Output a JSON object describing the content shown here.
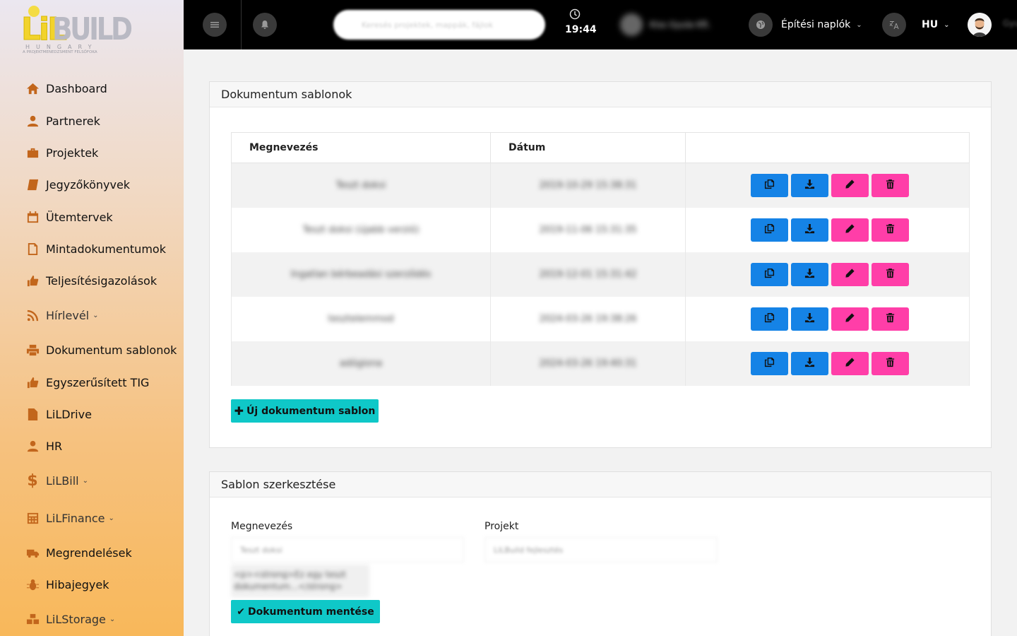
{
  "logo": {
    "brand_left": "LiL",
    "brand_right": "BUILD",
    "country": "HUNGARY",
    "tagline": "A PROJEKTMENEDZSMENT FELSŐFOKA"
  },
  "sidebar": {
    "items": [
      {
        "label": "Dashboard",
        "icon": "home-icon"
      },
      {
        "label": "Partnerek",
        "icon": "user-icon"
      },
      {
        "label": "Projektek",
        "icon": "briefcase-icon"
      },
      {
        "label": "Jegyzőkönyvek",
        "icon": "book-icon"
      },
      {
        "label": "Ütemtervek",
        "icon": "calendar-icon"
      },
      {
        "label": "Mintadokumentumok",
        "icon": "file-code-icon"
      },
      {
        "label": "Teljesítésigazolások",
        "icon": "thumbs-up-icon"
      },
      {
        "label": "Hírlevél",
        "icon": "rss-icon",
        "dropdown": true
      },
      {
        "label": "Dokumentum sablonok",
        "icon": "print-icon"
      },
      {
        "label": "Egyszerűsített TIG",
        "icon": "thumbs-up-icon"
      },
      {
        "label": "LiLDrive",
        "icon": "file-icon"
      },
      {
        "label": "HR",
        "icon": "user-icon"
      },
      {
        "label": "LiLBill",
        "icon": "dollar-icon",
        "dropdown": true
      },
      {
        "label": "LiLFinance",
        "icon": "calculator-icon",
        "dropdown": true
      },
      {
        "label": "Megrendelések",
        "icon": "truck-icon"
      },
      {
        "label": "Hibajegyek",
        "icon": "bug-icon"
      },
      {
        "label": "LiLStorage",
        "icon": "cubes-icon",
        "dropdown": true
      }
    ]
  },
  "topbar": {
    "search_placeholder": "Keresés projektek, mappák, fájlok",
    "time": "19:44",
    "user_name": "Kiss Gyula Kft.",
    "diaries_label": "Építési naplók",
    "language": "HU",
    "profile_name": "Gyula"
  },
  "templates_card": {
    "title": "Dokumentum sablonok",
    "columns": {
      "name": "Megnevezés",
      "date": "Dátum",
      "actions": ""
    },
    "rows": [
      {
        "name": "Teszt doksi",
        "date": "2019-10-29 15:38:31"
      },
      {
        "name": "Teszt doksi (újabb verzió)",
        "date": "2019-11-06 15:31:35"
      },
      {
        "name": "Ingatlan bérbeadási szerződés",
        "date": "2019-12-01 15:31:42"
      },
      {
        "name": "tesztelemmod",
        "date": "2024-03-26 19:38:26"
      },
      {
        "name": "adógiona",
        "date": "2024-03-26 19:40:31"
      }
    ],
    "new_button": "Új dokumentum sablon"
  },
  "edit_card": {
    "title": "Sablon szerkesztése",
    "name_label": "Megnevezés",
    "name_value": "Teszt doksi",
    "project_label": "Projekt",
    "project_value": "LiLBuild fejlesztés",
    "preview_text": "<p><strong>Ez egy teszt dokumentum...</strong>",
    "save_button": "Dokumentum mentése"
  },
  "colors": {
    "topbar": "#000000",
    "blue_button": "#1583e6",
    "pink_button": "#ff3ea8",
    "teal_button": "#0fc8c8",
    "icon_accent": "#c2661c"
  }
}
